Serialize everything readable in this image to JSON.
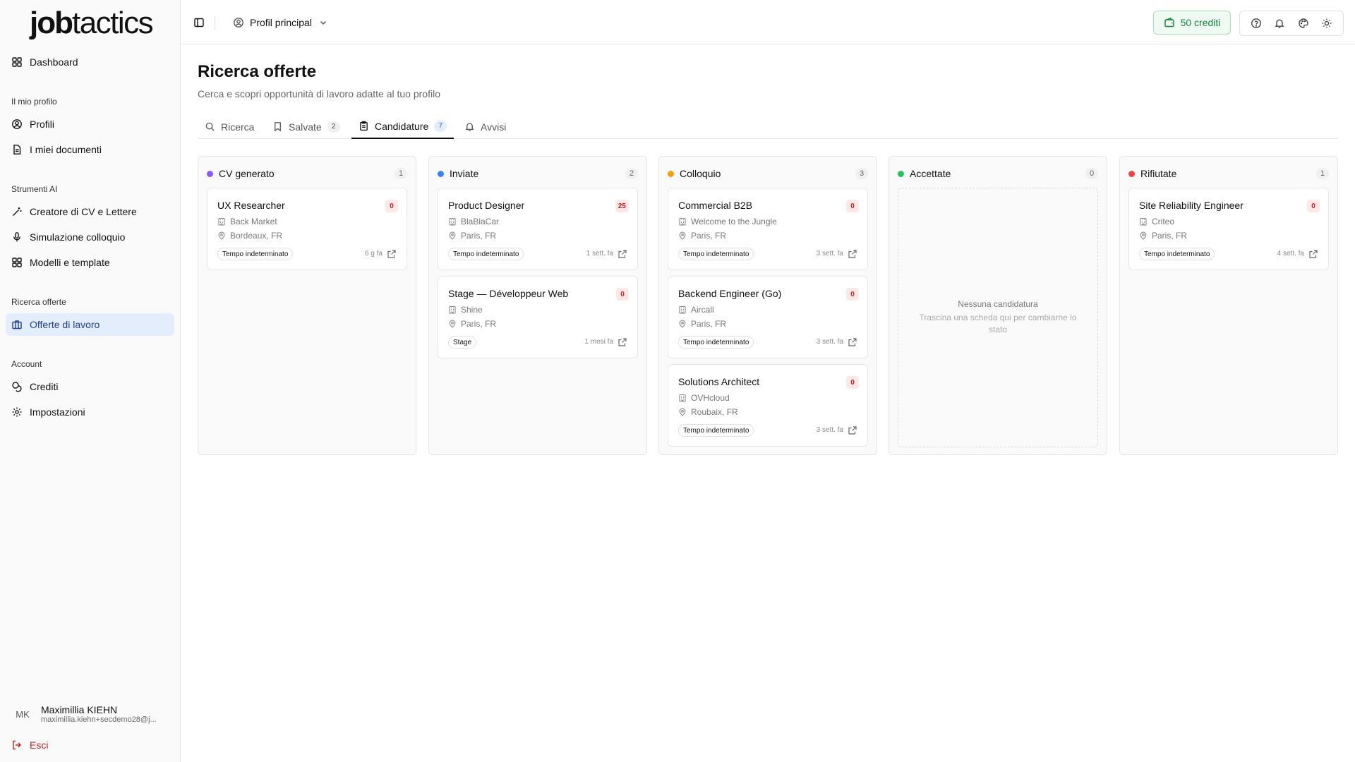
{
  "app": {
    "logo_bold": "job",
    "logo_thin": "tactics"
  },
  "sidebar": {
    "dashboard": "Dashboard",
    "section_profile": "Il mio profilo",
    "profiles": "Profili",
    "documents": "I miei documenti",
    "section_ai": "Strumenti AI",
    "cv_creator": "Creatore di CV e Lettere",
    "interview_sim": "Simulazione colloquio",
    "templates": "Modelli e template",
    "section_jobs": "Ricerca offerte",
    "job_offers": "Offerte di lavoro",
    "section_account": "Account",
    "credits": "Crediti",
    "settings": "Impostazioni",
    "user": {
      "initials": "MK",
      "name": "Maximillia KIEHN",
      "email": "maximillia.kiehn+secdemo28@j..."
    },
    "logout": "Esci"
  },
  "header": {
    "profile_select": "Profil principal",
    "credits": "50 crediti",
    "accent_color": "#15803d"
  },
  "page": {
    "title": "Ricerca offerte",
    "subtitle": "Cerca e scopri opportunità di lavoro adatte al tuo profilo"
  },
  "tabs": [
    {
      "label": "Ricerca",
      "count": ""
    },
    {
      "label": "Salvate",
      "count": "2"
    },
    {
      "label": "Candidature",
      "count": "7"
    },
    {
      "label": "Avvisi",
      "count": ""
    }
  ],
  "columns": [
    {
      "title": "CV generato",
      "count": "1",
      "color": "#8b5cf6",
      "cards": [
        {
          "title": "UX Researcher",
          "score": "0",
          "company": "Back Market",
          "location": "Bordeaux, FR",
          "type": "Tempo indeterminato",
          "time": "6 g fa"
        }
      ]
    },
    {
      "title": "Inviate",
      "count": "2",
      "color": "#3b82f6",
      "cards": [
        {
          "title": "Product Designer",
          "score": "25",
          "company": "BlaBlaCar",
          "location": "Paris, FR",
          "type": "Tempo indeterminato",
          "time": "1 sett. fa"
        },
        {
          "title": "Stage — Développeur Web",
          "score": "0",
          "company": "Shine",
          "location": "Paris, FR",
          "type": "Stage",
          "time": "1 mesi fa"
        }
      ]
    },
    {
      "title": "Colloquio",
      "count": "3",
      "color": "#f59e0b",
      "cards": [
        {
          "title": "Commercial B2B",
          "score": "0",
          "company": "Welcome to the Jungle",
          "location": "Paris, FR",
          "type": "Tempo indeterminato",
          "time": "3 sett. fa"
        },
        {
          "title": "Backend Engineer (Go)",
          "score": "0",
          "company": "Aircall",
          "location": "Paris, FR",
          "type": "Tempo indeterminato",
          "time": "3 sett. fa"
        },
        {
          "title": "Solutions Architect",
          "score": "0",
          "company": "OVHcloud",
          "location": "Roubaix, FR",
          "type": "Tempo indeterminato",
          "time": "3 sett. fa"
        }
      ]
    },
    {
      "title": "Accettate",
      "count": "0",
      "color": "#22c55e",
      "empty_title": "Nessuna candidatura",
      "empty_hint": "Trascina una scheda qui per cambiarne lo stato",
      "cards": []
    },
    {
      "title": "Rifiutate",
      "count": "1",
      "color": "#ef4444",
      "cards": [
        {
          "title": "Site Reliability Engineer",
          "score": "0",
          "company": "Criteo",
          "location": "Paris, FR",
          "type": "Tempo indeterminato",
          "time": "4 sett. fa"
        }
      ]
    }
  ]
}
